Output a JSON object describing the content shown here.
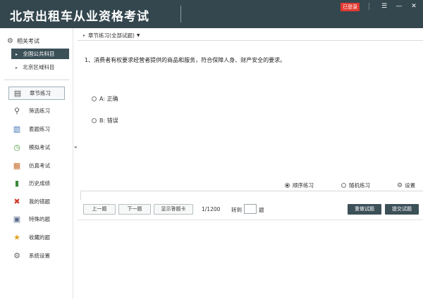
{
  "app": {
    "title": "北京出租车从业资格考试",
    "login_badge": "已登录",
    "window_controls": [
      "menu-icon",
      "minimize-icon",
      "close-icon"
    ]
  },
  "sidebar": {
    "section_label": "相关考试",
    "subjects": [
      {
        "label": "全国公共科目",
        "active": true
      },
      {
        "label": "北京区域科目",
        "active": false
      }
    ],
    "nav": [
      {
        "label": "章节练习",
        "icon": "book-icon",
        "active": true
      },
      {
        "label": "筛选练习",
        "icon": "search-icon",
        "active": false
      },
      {
        "label": "套题练习",
        "icon": "chart-icon",
        "active": false
      },
      {
        "label": "模拟考试",
        "icon": "clock-icon",
        "active": false
      },
      {
        "label": "仿真考试",
        "icon": "calendar-icon",
        "active": false
      },
      {
        "label": "历史成绩",
        "icon": "bar-chart-icon",
        "active": false
      },
      {
        "label": "我的错题",
        "icon": "x-icon",
        "active": false
      },
      {
        "label": "特殊的题",
        "icon": "clipboard-icon",
        "active": false
      },
      {
        "label": "收藏的题",
        "icon": "star-icon",
        "active": false
      },
      {
        "label": "系统设置",
        "icon": "gear-icon",
        "active": false
      }
    ]
  },
  "main": {
    "breadcrumb": "章节练习(全部试题)",
    "question": "1、消费者有权要求经营者提供的商品和服务，符合保障人身、财产安全的要求。",
    "options": [
      {
        "label": "A: 正确"
      },
      {
        "label": "B: 错误"
      }
    ],
    "modes": {
      "sequential": "顺序练习",
      "random": "随机练习",
      "settings": "设置"
    },
    "toolbar": {
      "prev": "上一题",
      "next": "下一题",
      "show_answer": "显示答题卡",
      "counter": "1/1200",
      "jump_prefix": "转到",
      "jump_suffix": "题",
      "jump_value": "",
      "reset": "重做试题",
      "submit": "提交试题"
    }
  },
  "colors": {
    "titlebar": "#34474f",
    "accent": "#3c5058",
    "badge": "#e23a32"
  }
}
